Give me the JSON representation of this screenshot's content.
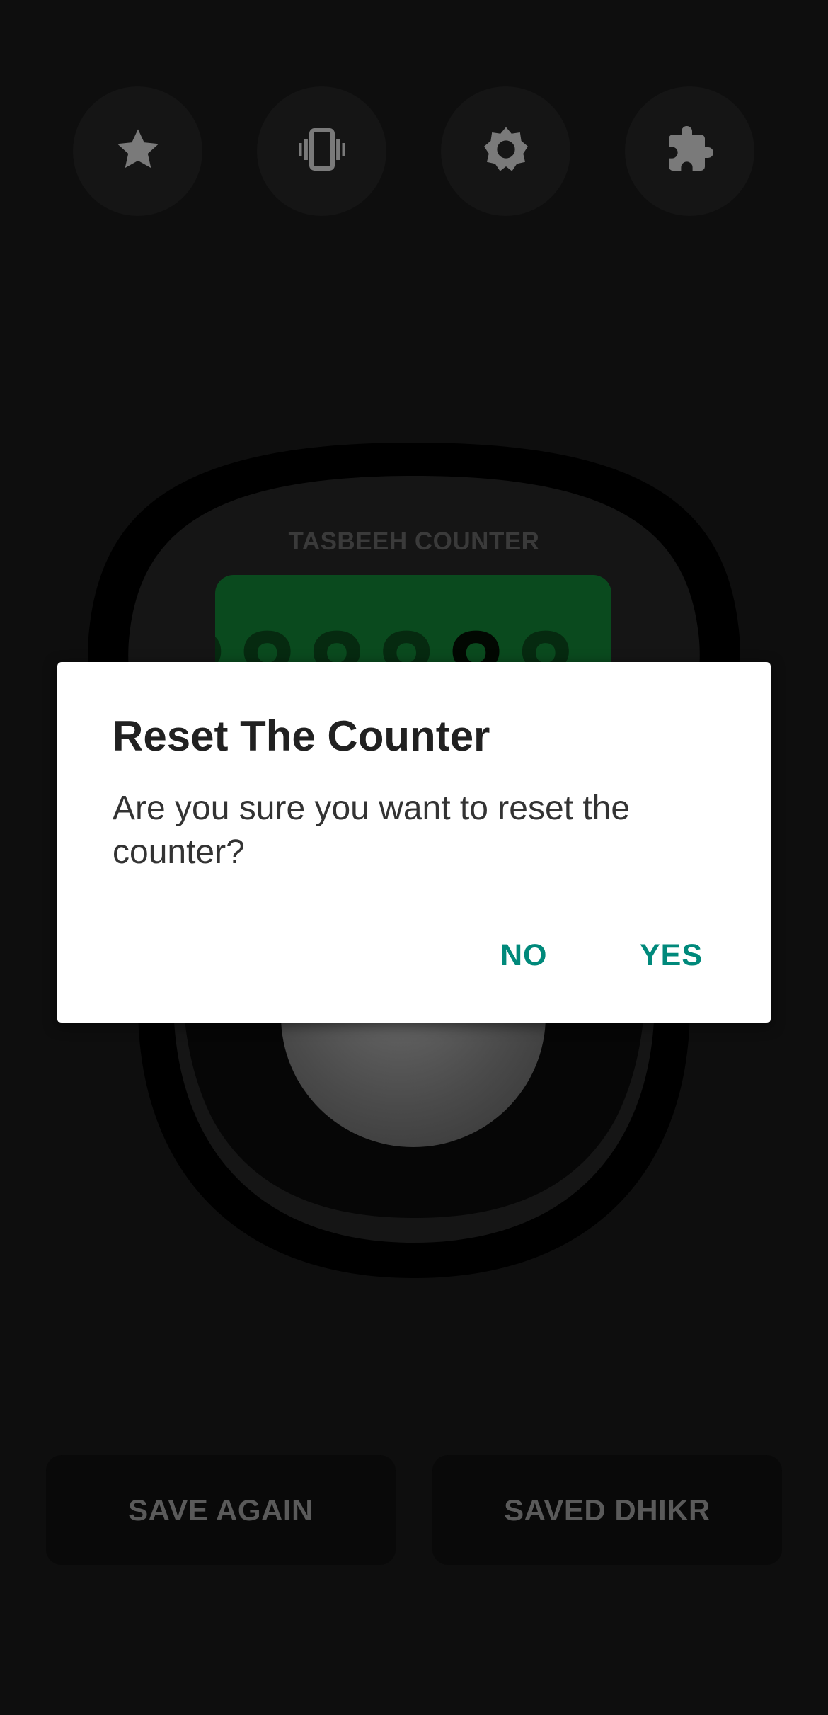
{
  "toolbar": {
    "icons": [
      "star-icon",
      "vibrate-icon",
      "brightness-icon",
      "puzzle-icon"
    ]
  },
  "device": {
    "title": "TASBEEH COUNTER",
    "lcd_color": "#0a4a1e"
  },
  "dialog": {
    "title": "Reset The Counter",
    "message": "Are you sure you want to reset the counter?",
    "no_label": "NO",
    "yes_label": "YES",
    "accent_color": "#00897b"
  },
  "bottom": {
    "save_again_label": "SAVE AGAIN",
    "saved_dhikr_label": "SAVED DHIKR"
  }
}
